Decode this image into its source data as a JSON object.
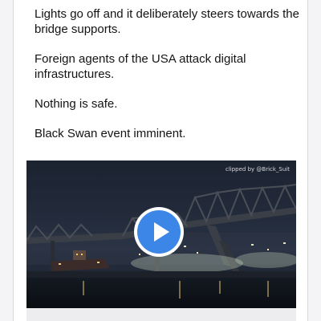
{
  "post": {
    "paragraphs": [
      "Lights go off and it deliberately steers towards the bridge supports.",
      "Foreign agents of the USA attack digital infrastructures.",
      "Nothing is safe.",
      "Black Swan event imminent."
    ]
  },
  "video": {
    "watermark": "clipped by @Brick_Suit",
    "play_icon": "play-icon",
    "accent_color": "#3c86e8"
  }
}
